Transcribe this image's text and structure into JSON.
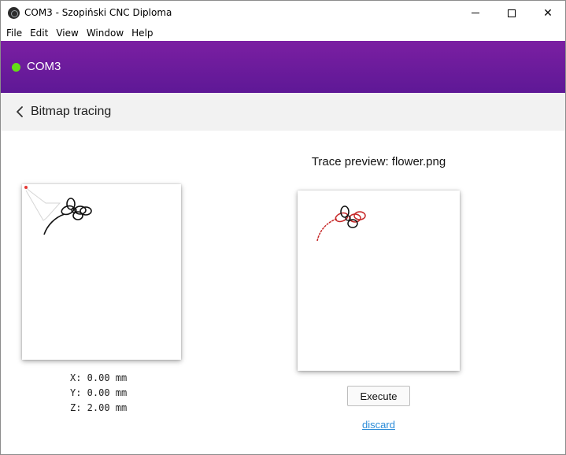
{
  "window": {
    "title": "COM3 - Szopiński CNC Diploma",
    "minimize_glyph": "",
    "close_glyph": "✕"
  },
  "menu": {
    "items": [
      "File",
      "Edit",
      "View",
      "Window",
      "Help"
    ]
  },
  "header": {
    "port": "COM3",
    "status_color": "#64dd17",
    "accent": "#6a1b9a"
  },
  "subheader": {
    "title": "Bitmap tracing",
    "back_icon": "chevron-left-icon"
  },
  "machine": {
    "x_line": "X: 0.00 mm",
    "y_line": "Y: 0.00 mm",
    "z_line": "Z: 2.00 mm"
  },
  "preview": {
    "title": "Trace preview: flower.png"
  },
  "actions": {
    "execute_label": "Execute",
    "discard_label": "discard"
  }
}
